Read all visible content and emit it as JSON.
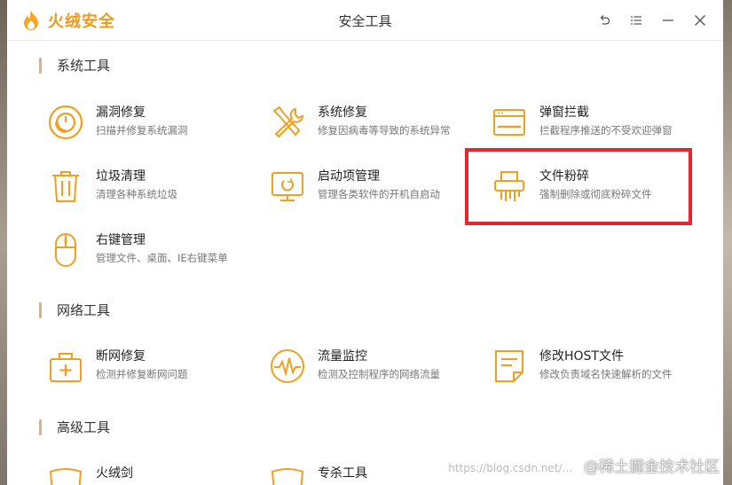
{
  "app": {
    "brand": "火绒安全",
    "window_title": "安全工具"
  },
  "controls": [
    {
      "icon": "back-icon"
    },
    {
      "icon": "menu-icon"
    },
    {
      "icon": "minimize-icon"
    },
    {
      "icon": "close-icon"
    }
  ],
  "sections": [
    {
      "title": "系统工具",
      "tools": [
        {
          "name": "漏洞修复",
          "desc": "扫描并修复系统漏洞",
          "icon": "vulnerability-repair-icon"
        },
        {
          "name": "系统修复",
          "desc": "修复因病毒等导致的系统异常",
          "icon": "system-repair-icon"
        },
        {
          "name": "弹窗拦截",
          "desc": "拦截程序推送的不受欢迎弹窗",
          "icon": "popup-block-icon"
        },
        {
          "name": "垃圾清理",
          "desc": "清理各种系统垃圾",
          "icon": "trash-clean-icon"
        },
        {
          "name": "启动项管理",
          "desc": "管理各类软件的开机自启动",
          "icon": "startup-manager-icon"
        },
        {
          "name": "文件粉碎",
          "desc": "强制删除或彻底粉碎文件",
          "icon": "file-shredder-icon"
        },
        {
          "name": "右键管理",
          "desc": "管理文件、桌面、IE右键菜单",
          "icon": "mouse-right-click-icon"
        }
      ]
    },
    {
      "title": "网络工具",
      "tools": [
        {
          "name": "断网修复",
          "desc": "检测并修复断网问题",
          "icon": "network-repair-icon"
        },
        {
          "name": "流量监控",
          "desc": "检测及控制程序的网络流量",
          "icon": "traffic-monitor-icon"
        },
        {
          "name": "修改HOST文件",
          "desc": "修改负责域名快速解析的文件",
          "icon": "host-file-icon"
        }
      ]
    },
    {
      "title": "高级工具",
      "tools": [
        {
          "name": "火绒剑",
          "desc": "",
          "icon": "huorong-sword-icon"
        },
        {
          "name": "专杀工具",
          "desc": "",
          "icon": "special-kill-icon"
        }
      ]
    }
  ],
  "watermark": {
    "url": "https://blog.csdn.net/...",
    "text": "@稀土掘金技术社区"
  },
  "colors": {
    "accent": "#f0a020",
    "highlight": "#e3262f"
  }
}
